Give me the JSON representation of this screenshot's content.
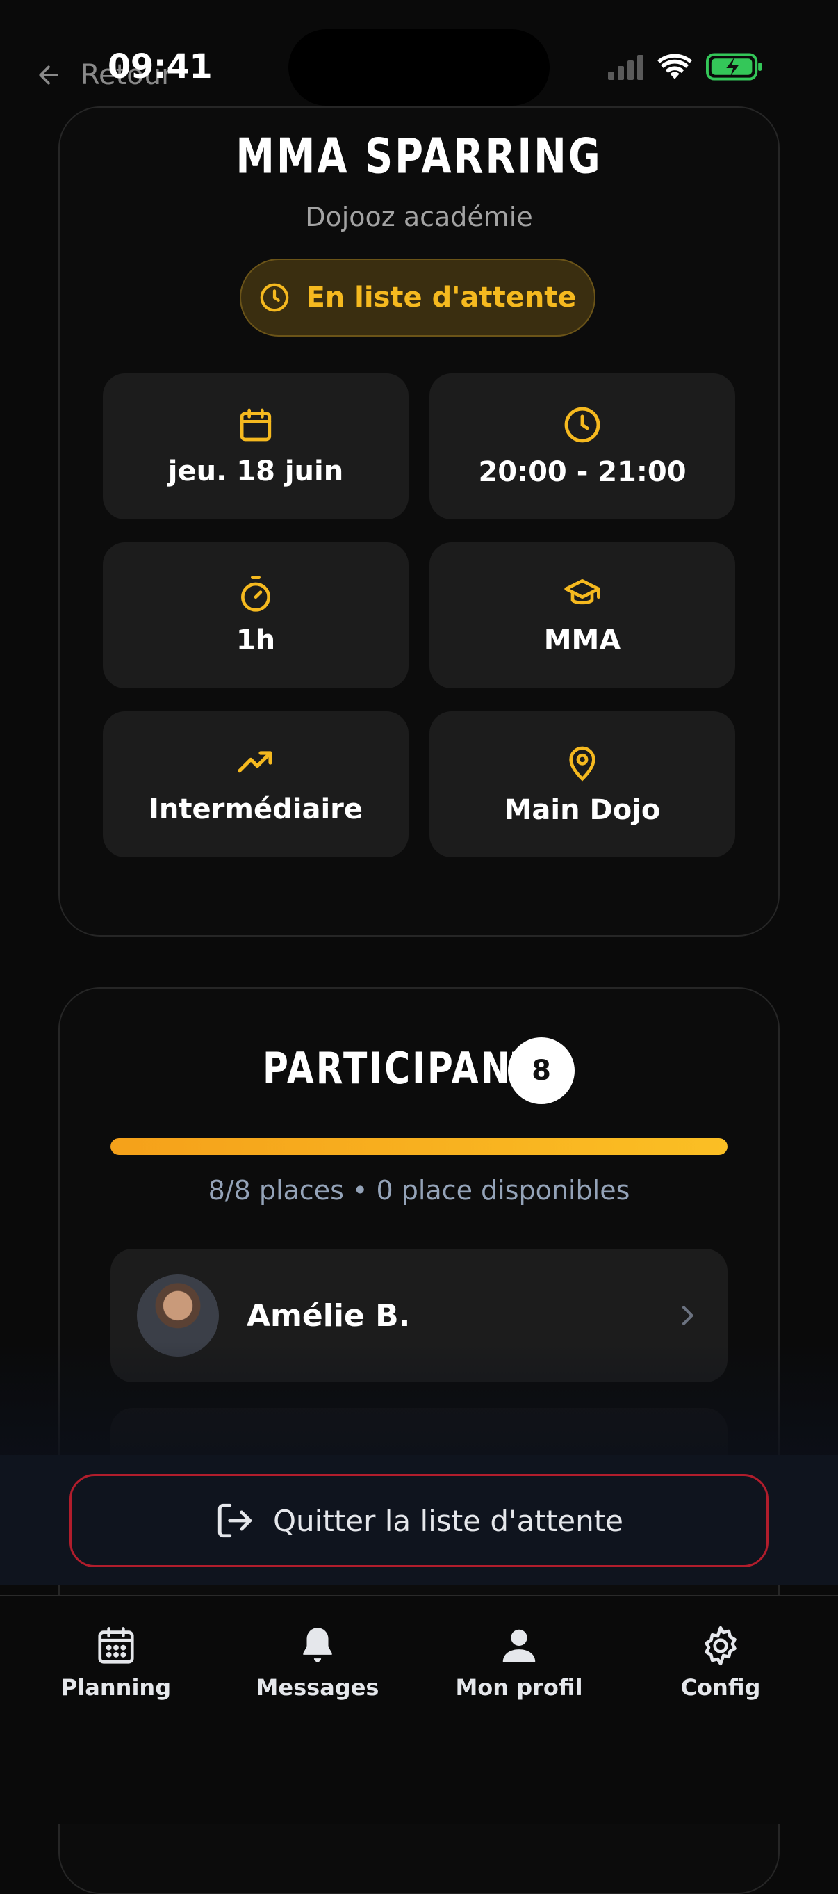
{
  "status_bar": {
    "time": "09:41"
  },
  "nav": {
    "back_label": "Retour"
  },
  "session": {
    "title": "MMA SPARRING",
    "academy": "Dojooz académie",
    "status_label": "En liste d'attente",
    "details": {
      "date": "jeu. 18 juin",
      "time_range": "20:00 - 21:00",
      "duration": "1h",
      "discipline": "MMA",
      "level": "Intermédiaire",
      "location": "Main Dojo"
    }
  },
  "participants": {
    "title": "PARTICIPANTS",
    "count": "8",
    "fill_fraction": 1.0,
    "places_text": "8/8 places • 0 place disponibles",
    "list": [
      {
        "name": "Amélie B."
      }
    ]
  },
  "action": {
    "quit_label": "Quitter la liste d'attente"
  },
  "tabbar": {
    "items": [
      {
        "label": "Planning",
        "icon": "calendar-icon"
      },
      {
        "label": "Messages",
        "icon": "bell-icon"
      },
      {
        "label": "Mon profil",
        "icon": "user-icon"
      },
      {
        "label": "Config",
        "icon": "gear-icon"
      }
    ]
  },
  "colors": {
    "accent": "#f5b91f",
    "danger_border": "#b11d2c",
    "background": "#0a0a0a",
    "tile": "#1c1c1c"
  }
}
